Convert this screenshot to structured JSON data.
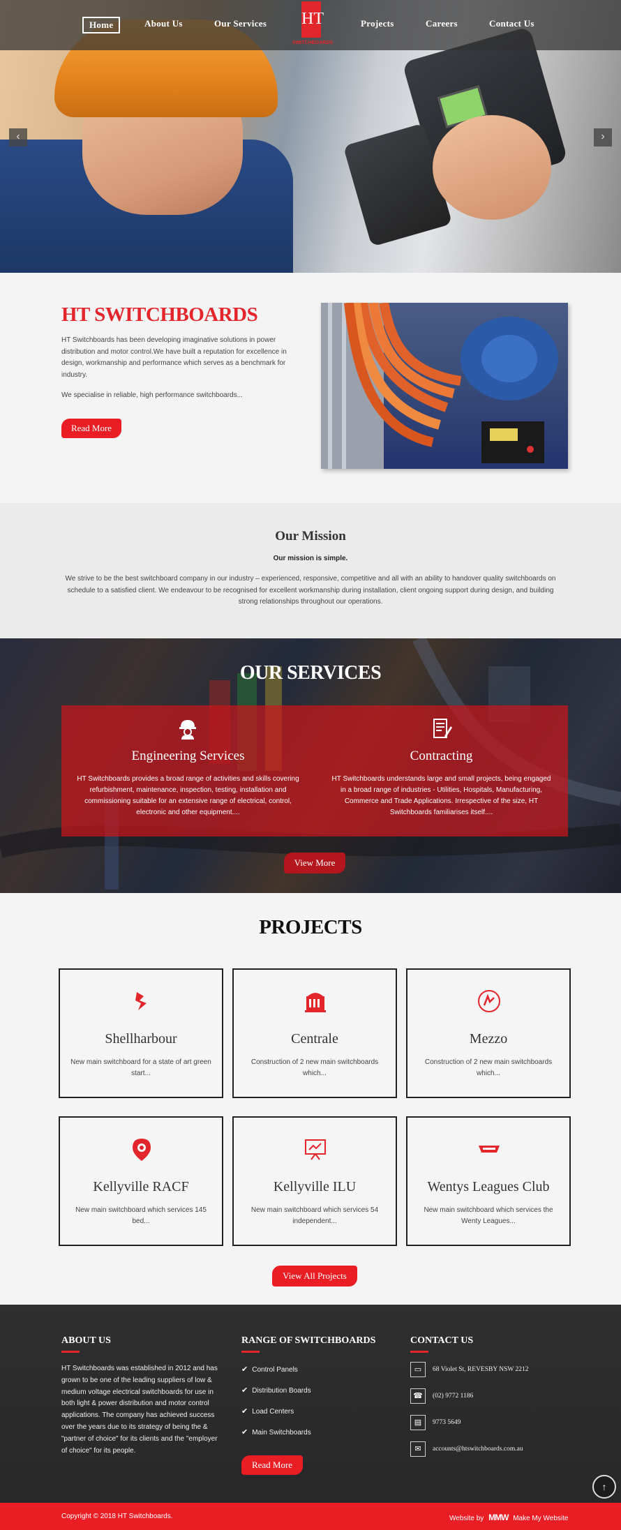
{
  "nav": {
    "items": [
      "Home",
      "About Us",
      "Our Services",
      "Projects",
      "Careers",
      "Contact Us"
    ],
    "logo_mark": "HT",
    "logo_text": "SWITCHBOARDS",
    "prev_arrow": "‹",
    "next_arrow": "›"
  },
  "about": {
    "title": "HT SWITCHBOARDS",
    "paragraph1": "HT Switchboards has been developing imaginative solutions in power distribution and motor control.We have built a reputation for excellence in design, workmanship and performance which serves as a benchmark for industry.",
    "paragraph2": "We specialise in reliable, high performance switchboards...",
    "button": "Read More"
  },
  "mission": {
    "title": "Our Mission",
    "subtitle": "Our mission is simple.",
    "text": "We strive to be the best switchboard company in our industry – experienced, responsive, competitive and all with an ability to handover quality switchboards on schedule to a satisfied client. We endeavour to be recognised for excellent workmanship during installation, client ongoing support during design, and building strong relationships throughout our operations."
  },
  "services": {
    "title": "OUR SERVICES",
    "items": [
      {
        "name": "Engineering Services",
        "desc": "HT Switchboards provides a broad range of activities and skills covering refurbishment, maintenance, inspection, testing, installation and commissioning suitable for an extensive range of electrical, control, electronic and other equipment....",
        "icon": "engineer-helmet-icon"
      },
      {
        "name": "Contracting",
        "desc": "HT Switchboards understands large and small projects, being engaged in a broad range of industries - Utilities, Hospitals, Manufacturing, Commerce and Trade Applications. Irrespective of the size, HT Switchboards familiarises itself....",
        "icon": "contract-document-icon"
      }
    ],
    "button": "View More"
  },
  "projects": {
    "title": "PROJECTS",
    "items": [
      {
        "name": "Shellharbour",
        "desc": "New main switchboard for a state of art green start..."
      },
      {
        "name": "Centrale",
        "desc": "Construction of 2 new main switchboards which..."
      },
      {
        "name": "Mezzo",
        "desc": "Construction of 2 new main switchboards which..."
      },
      {
        "name": "Kellyville RACF",
        "desc": "New main switchboard which services 145 bed..."
      },
      {
        "name": "Kellyville ILU",
        "desc": "New main switchboard which services 54 independent..."
      },
      {
        "name": "Wentys Leagues Club",
        "desc": "New main switchboard which services the Wenty Leagues..."
      }
    ],
    "button": "View All Projects"
  },
  "footer": {
    "about_heading": "ABOUT US",
    "about_text": "HT Switchboards was established in 2012 and has grown to be one of the leading suppliers of low & medium voltage electrical switchboards for use in both light & power distribution and motor control applications. The company has achieved success over the years due to its strategy of being the & \"partner of choice\" for its clients and the \"employer of choice\" for its people.",
    "range_heading": "RANGE OF SWITCHBOARDS",
    "range_items": [
      "Control Panels",
      "Distribution Boards",
      "Load Centers",
      "Main Switchboards"
    ],
    "range_button": "Read More",
    "contact_heading": "CONTACT US",
    "address": "68 Violet St, REVESBY NSW 2212",
    "phone": "(02) 9772 1186",
    "fax": "9773 5649",
    "email": "accounts@htswitchboards.com.au",
    "to_top": "↑",
    "copyright": "Copyright © 2018 HT Switchboards.",
    "credit_prefix": "Website by",
    "credit_logo": "MMW",
    "credit_name": "Make My Website"
  },
  "colors": {
    "accent": "#ea1c24",
    "footer": "#2d2d2d"
  }
}
